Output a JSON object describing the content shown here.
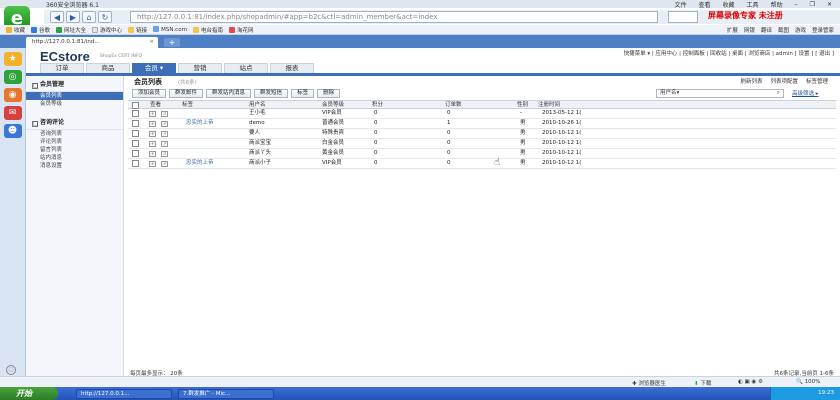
{
  "browser": {
    "title": "360安全浏览器 6.1",
    "menu": [
      "文件",
      "查看",
      "收藏",
      "工具",
      "帮助"
    ],
    "address_url": "http://127.0.0.1:81/index.php/shopadmin/#app=b2c&ctl=admin_member&act=index",
    "secure_mark": "e",
    "recorder_text": "屏幕录像专家 未注册",
    "bookmarks": [
      "收藏",
      "谷歌",
      "网址大全",
      "游戏中心",
      "链接",
      "MSN.com",
      "电台指南",
      "淘花网"
    ],
    "bookmarks_right": [
      "扩展",
      "网银",
      "翻译",
      "截图",
      "游戏",
      "登录管家"
    ],
    "tab_title": "http://127.0.0.1:81/ind...",
    "tab_close": "×",
    "new_tab": "+"
  },
  "ecstore": {
    "logo": "ECstore",
    "subtitle": "ShopEx CERT INFO",
    "top_links": "快捷菜单 ▾ | 应用中心 | 控制面板 | 回收站 | 桌面 | 浏览商店 | admin [ 设置 ] [ 退出 ]",
    "nav": [
      "订单",
      "商品",
      "会员 ▾",
      "营销",
      "站点",
      "报表"
    ],
    "nav_active_index": 2
  },
  "sidebar": {
    "sections": [
      {
        "title": "会员管理",
        "items": [
          "会员列表",
          "会员等级"
        ],
        "active_index": 0
      },
      {
        "title": "咨询评论",
        "items": [
          "咨询列表",
          "评论列表",
          "留言列表",
          "站内消息",
          "消息设置"
        ],
        "active_index": -1
      }
    ],
    "collapse_mark": "□"
  },
  "main": {
    "title": "会员列表",
    "count": "(共6条)",
    "right_links": [
      "刷新列表",
      "列表项配置",
      "标签管理"
    ],
    "toolbar": [
      "添加会员",
      "群发邮件",
      "群发站内消息",
      "群发短信",
      "标签",
      "删除"
    ],
    "filter_placeholder": "用户名▾",
    "search_icon": "magnifier-icon",
    "advanced": "高级筛选 ▸",
    "columns": [
      "查看",
      "标签",
      "用户名",
      "会员等级",
      "积分",
      "订单数",
      "性别",
      "注册时间"
    ],
    "rows": [
      {
        "tag": "",
        "username": "王小毛",
        "level": "VIP会员",
        "points": "0",
        "orders": "0",
        "gender": "-",
        "reg": "2013-05-12 1("
      },
      {
        "tag": "忠实的上帝",
        "username": "demo",
        "level": "普通会员",
        "points": "0",
        "orders": "1",
        "gender": "男",
        "reg": "2010-10-26 1("
      },
      {
        "tag": "",
        "username": "要人",
        "level": "特殊贵宾",
        "points": "0",
        "orders": "0",
        "gender": "男",
        "reg": "2010-10-12 1("
      },
      {
        "tag": "",
        "username": "商派宝宝",
        "level": "白金会员",
        "points": "0",
        "orders": "0",
        "gender": "男",
        "reg": "2010-10-12 1("
      },
      {
        "tag": "",
        "username": "商派丫头",
        "level": "黄金会员",
        "points": "0",
        "orders": "0",
        "gender": "男",
        "reg": "2010-10-12 1("
      },
      {
        "tag": "忠实的上帝",
        "username": "商派小子",
        "level": "VIP会员",
        "points": "0",
        "orders": "0",
        "gender": "男",
        "reg": "2010-10-12 1("
      }
    ],
    "pager_left": "每页最多显示： 20条",
    "pager_right": "共6条记录,当前页 1-6条"
  },
  "status": {
    "doctor": "浏览器医生",
    "download": "下载",
    "zoom": "100%"
  },
  "taskbar": {
    "start": "开始",
    "tasks": [
      "http://127.0.0.1...",
      "7.群发推广 - Mic..."
    ],
    "clock": "19:23"
  }
}
